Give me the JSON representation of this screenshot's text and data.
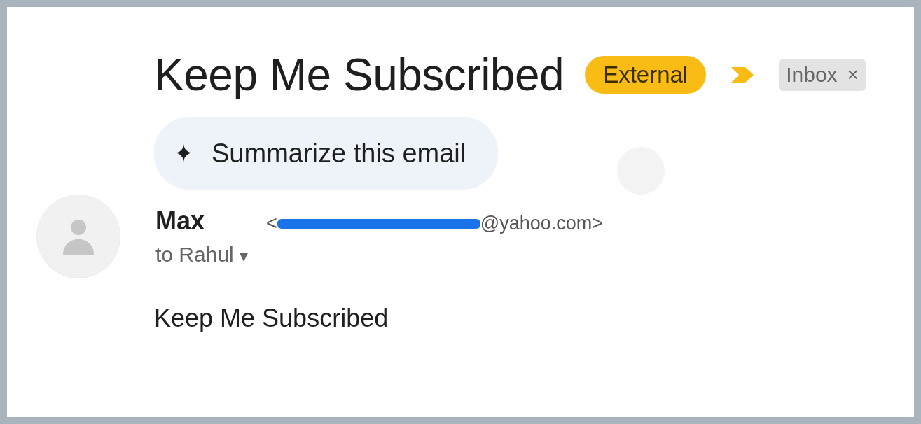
{
  "subject": "Keep Me Subscribed",
  "labels": [
    {
      "kind": "badge",
      "text": "External"
    },
    {
      "kind": "importance"
    },
    {
      "kind": "chip",
      "text": "Inbox",
      "close": "×"
    }
  ],
  "summarize_button": {
    "icon": "✦",
    "label": "Summarize this email"
  },
  "sender": {
    "name": "Max",
    "email_start": "<",
    "email_end": "@yahoo.com>",
    "redacted": true
  },
  "recipient": {
    "text": "to Rahul",
    "caret": "▾"
  },
  "body": "Keep Me Subscribed"
}
